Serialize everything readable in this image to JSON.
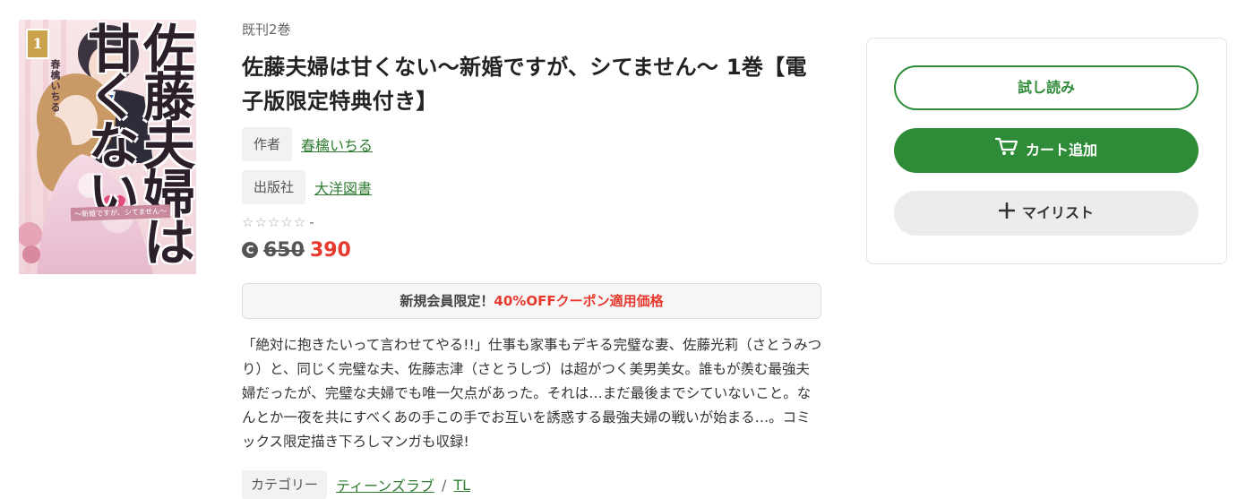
{
  "cover": {
    "volume_number": "1",
    "author_text": "春檎いちる",
    "title_text": "佐藤夫婦は甘くない",
    "series_text": "〜新婚ですが、シてません〜"
  },
  "book": {
    "volume_count": "既刊2巻",
    "title": "佐藤夫婦は甘くない〜新婚ですが、シてません〜 1巻【電子版限定特典付き】",
    "author_label": "作者",
    "author": "春檎いちる",
    "publisher_label": "出版社",
    "publisher": "大洋図書",
    "rating_stars": "☆☆☆☆☆",
    "rating_value": "-",
    "coin_icon": "coin-icon",
    "price_old": "650",
    "price_new": "390"
  },
  "coupon": {
    "prefix": "新規会員限定！",
    "highlight": "40%OFFクーポン適用価格"
  },
  "description": "「絶対に抱きたいって言わせてやる!!」仕事も家事もデキる完璧な妻、佐藤光莉（さとうみつり）と、同じく完璧な夫、佐藤志津（さとうしづ）は超がつく美男美女。誰もが羨む最強夫婦だったが、完璧な夫婦でも唯一欠点があった。それは…まだ最後までシていないこと。なんとか一夜を共にすべくあの手この手でお互いを誘惑する最強夫婦の戦いが始まる…。コミックス限定描き下ろしマンガも収録!",
  "category": {
    "label": "カテゴリー",
    "links": [
      "ティーンズラブ",
      "TL"
    ],
    "separator": "/"
  },
  "actions": {
    "trial_label": "試し読み",
    "cart_label": "カート追加",
    "mylist_label": "マイリスト",
    "cart_icon": "cart-icon",
    "plus_icon": "plus-icon"
  },
  "colors": {
    "accent_green": "#2e8b37",
    "sale_red": "#e8392e",
    "link_green": "#2f7d32"
  }
}
